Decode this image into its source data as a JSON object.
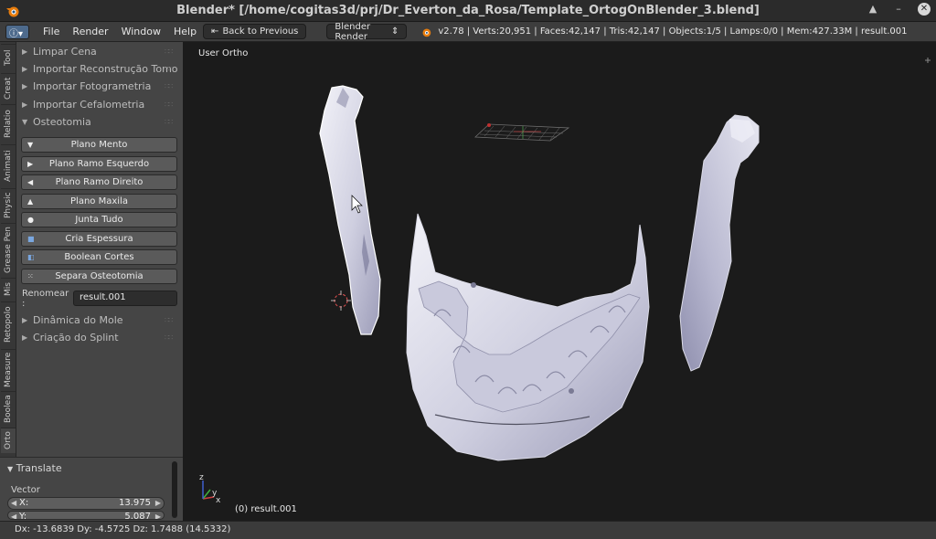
{
  "window": {
    "title": "Blender* [/home/cogitas3d/prj/Dr_Everton_da_Rosa/Template_OrtogOnBlender_3.blend]",
    "controls": [
      "▲",
      "–",
      "✕"
    ]
  },
  "menubar": {
    "menus": [
      "File",
      "Render",
      "Window",
      "Help"
    ],
    "back_button": "Back to Previous",
    "render_engine": "Blender Render",
    "stats": "v2.78 | Verts:20,951 | Faces:42,147 | Tris:42,147 | Objects:1/5 | Lamps:0/0 | Mem:427.33M | result.001"
  },
  "tabs": [
    "Tool",
    "Creat",
    "Relatio",
    "Animati",
    "Physic",
    "Grease Pen",
    "Mis",
    "Retopolo",
    "Measure",
    "Boolea",
    "Orto"
  ],
  "toolpanel": {
    "collapsed_top": [
      "Limpar Cena",
      "Importar Reconstrução Tomo",
      "Importar Fotogrametria",
      "Importar Cefalometria"
    ],
    "open_section": "Osteotomia",
    "buttons": [
      {
        "label": "Plano Mento",
        "icon": "▼"
      },
      {
        "label": "Plano Ramo Esquerdo",
        "icon": "▶"
      },
      {
        "label": "Plano Ramo Direito",
        "icon": "◀"
      },
      {
        "label": "Plano Maxila",
        "icon": "▲"
      },
      {
        "label": "Junta Tudo",
        "icon": "●"
      },
      {
        "label": "Cria Espessura",
        "icon": "■"
      },
      {
        "label": "Boolean Cortes",
        "icon": "◧"
      },
      {
        "label": "Separa Osteotomia",
        "icon": "⁙"
      }
    ],
    "rename": {
      "label": "Renomear :",
      "value": "result.001"
    },
    "collapsed_bottom": [
      "Dinâmica do Mole",
      "Criação do Splint"
    ]
  },
  "operator": {
    "title": "Translate",
    "sub": "Vector",
    "fields": [
      {
        "key": "X:",
        "value": "13.975"
      },
      {
        "key": "Y:",
        "value": "5.087"
      }
    ]
  },
  "viewport": {
    "view_label": "User Ortho",
    "object_label": "(0) result.001",
    "axis": {
      "x": "x",
      "y": "y",
      "z": "z"
    }
  },
  "status": {
    "text": "Dx: -13.6839  Dy: -4.5725  Dz: 1.7488 (14.5332)"
  },
  "colors": {
    "bone": "#e2e2ec",
    "bone_shade": "#a8a8c0",
    "accent": "#4d6a8c"
  }
}
